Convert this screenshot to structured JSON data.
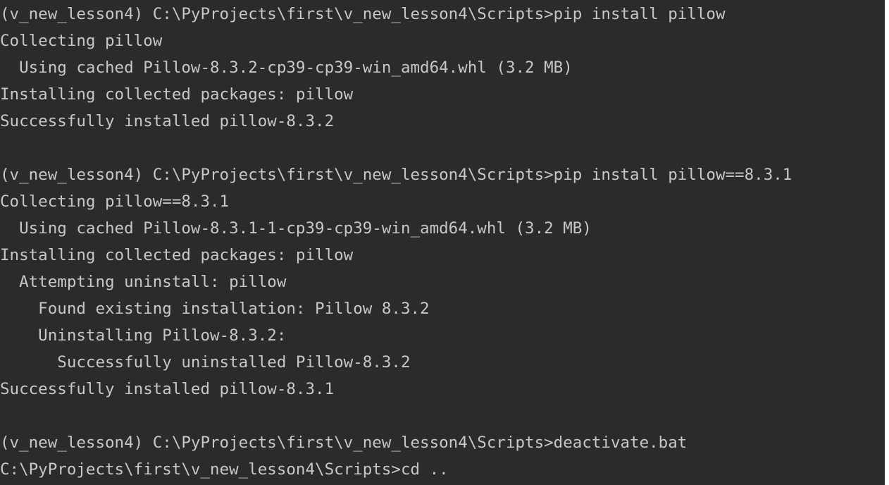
{
  "terminal": {
    "colors": {
      "background": "#2b2b2b",
      "text": "#c5c8c6"
    },
    "lines": [
      "(v_new_lesson4) C:\\PyProjects\\first\\v_new_lesson4\\Scripts>pip install pillow",
      "Collecting pillow",
      "  Using cached Pillow-8.3.2-cp39-cp39-win_amd64.whl (3.2 MB)",
      "Installing collected packages: pillow",
      "Successfully installed pillow-8.3.2",
      "",
      "(v_new_lesson4) C:\\PyProjects\\first\\v_new_lesson4\\Scripts>pip install pillow==8.3.1",
      "Collecting pillow==8.3.1",
      "  Using cached Pillow-8.3.1-1-cp39-cp39-win_amd64.whl (3.2 MB)",
      "Installing collected packages: pillow",
      "  Attempting uninstall: pillow",
      "    Found existing installation: Pillow 8.3.2",
      "    Uninstalling Pillow-8.3.2:",
      "      Successfully uninstalled Pillow-8.3.2",
      "Successfully installed pillow-8.3.1",
      "",
      "(v_new_lesson4) C:\\PyProjects\\first\\v_new_lesson4\\Scripts>deactivate.bat",
      "C:\\PyProjects\\first\\v_new_lesson4\\Scripts>cd .."
    ]
  }
}
